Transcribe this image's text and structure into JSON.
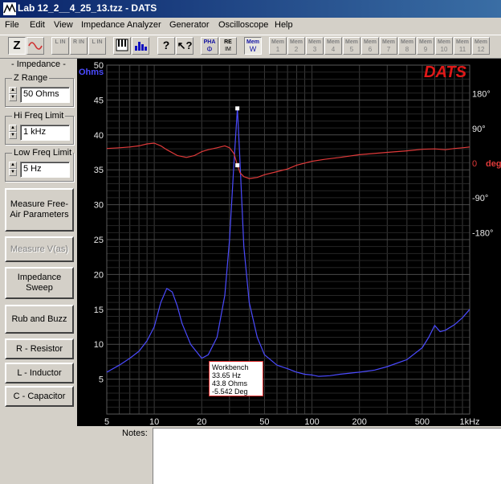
{
  "window": {
    "title": "Lab 12_2__4_25_13.tzz - DATS"
  },
  "menu": [
    "File",
    "Edit",
    "View",
    "Impedance Analyzer",
    "Generator",
    "Oscilloscope",
    "Help"
  ],
  "toolbar": {
    "z_label": "Z",
    "l_in_1": "L IN",
    "r_in_1": "R IN",
    "l_in_2": "L IN",
    "r_in_2": "R IN",
    "help_label": "?",
    "pha_top": "PHA",
    "pha_bot": "Φ",
    "re_top": "RE",
    "re_bot": "IM",
    "mem_label": "Mem",
    "mem_w": "W",
    "mem_slots": [
      "1",
      "2",
      "3",
      "4",
      "5",
      "6",
      "7",
      "8",
      "9",
      "10",
      "11",
      "12"
    ]
  },
  "left_panel": {
    "impedance_label": "- Impedance -",
    "z_range_label": "Z Range",
    "z_range_value": "50 Ohms",
    "hi_freq_label": "Hi Freq Limit",
    "hi_freq_value": "1 kHz",
    "low_freq_label": "Low Freq Limit",
    "low_freq_value": "5 Hz",
    "buttons": {
      "measure_free_air": "Measure Free-Air Parameters",
      "measure_vas": "Measure V(as)",
      "impedance_sweep": "Impedance Sweep",
      "rub_buzz": "Rub and Buzz",
      "r_resistor": "R - Resistor",
      "l_inductor": "L - Inductor",
      "c_capacitor": "C - Capacitor"
    }
  },
  "notes_label": "Notes:",
  "colors": {
    "impedance": "#4b4bff",
    "phase": "#e03a3a",
    "grid": "#3a3a3a",
    "background": "#000000",
    "logo": "#e01818"
  },
  "chart_data": {
    "type": "line",
    "logo": "DATS",
    "ylabel_left": "Ohms",
    "ylabel_right": "deg",
    "x_scale": "log",
    "xlim": [
      5,
      1000
    ],
    "ylim": [
      0,
      50
    ],
    "phase_lim": [
      -180,
      180
    ],
    "x_ticks": [
      "5",
      "10",
      "20",
      "50",
      "100",
      "200",
      "500",
      "1kHz"
    ],
    "x_tick_values": [
      5,
      10,
      20,
      50,
      100,
      200,
      500,
      1000
    ],
    "y_ticks": [
      50,
      45,
      40,
      35,
      30,
      25,
      20,
      15,
      10,
      5
    ],
    "phase_ticks": [
      "180°",
      "90°",
      "0",
      "-90°",
      "-180°"
    ],
    "phase_tick_values": [
      180,
      90,
      0,
      -90,
      -180
    ],
    "series": [
      {
        "id": "impedance",
        "x": [
          5,
          6,
          7,
          8,
          9,
          10,
          11,
          12,
          13,
          14,
          15,
          17,
          20,
          22,
          25,
          28,
          30,
          32,
          33.65,
          35,
          37,
          40,
          45,
          50,
          60,
          70,
          80,
          90,
          100,
          110,
          130,
          150,
          200,
          250,
          300,
          400,
          500,
          550,
          600,
          650,
          700,
          800,
          900,
          1000
        ],
        "y": [
          6,
          7,
          8,
          9,
          10.5,
          12.5,
          16,
          18,
          17.5,
          15.5,
          13,
          10,
          8,
          8.5,
          11,
          17,
          25,
          36,
          43.8,
          36,
          24,
          16,
          11,
          8.5,
          7,
          6.5,
          6,
          5.7,
          5.6,
          5.4,
          5.5,
          5.7,
          6,
          6.3,
          6.8,
          7.8,
          9.5,
          11,
          12.7,
          11.8,
          12,
          12.8,
          13.8,
          15
        ]
      },
      {
        "id": "phase",
        "x": [
          5,
          6,
          7,
          8,
          9,
          10,
          11,
          12,
          14,
          16,
          18,
          20,
          22,
          25,
          28,
          30,
          32,
          33.65,
          35,
          37,
          40,
          45,
          50,
          60,
          70,
          80,
          100,
          120,
          150,
          200,
          300,
          400,
          500,
          600,
          700,
          800,
          900,
          1000
        ],
        "y": [
          38,
          40,
          42,
          45,
          50,
          52,
          45,
          35,
          20,
          15,
          20,
          30,
          35,
          40,
          45,
          40,
          25,
          -5.5,
          -25,
          -35,
          -40,
          -37,
          -30,
          -22,
          -15,
          -5,
          5,
          10,
          15,
          22,
          28,
          32,
          36,
          37,
          35,
          38,
          40,
          42
        ]
      }
    ],
    "marker": {
      "x": 33.65,
      "z": 43.8,
      "phase": -5.542
    },
    "annotation": [
      "Workbench",
      "33.65 Hz",
      "43.8 Ohms",
      "-5.542 Deg"
    ]
  }
}
